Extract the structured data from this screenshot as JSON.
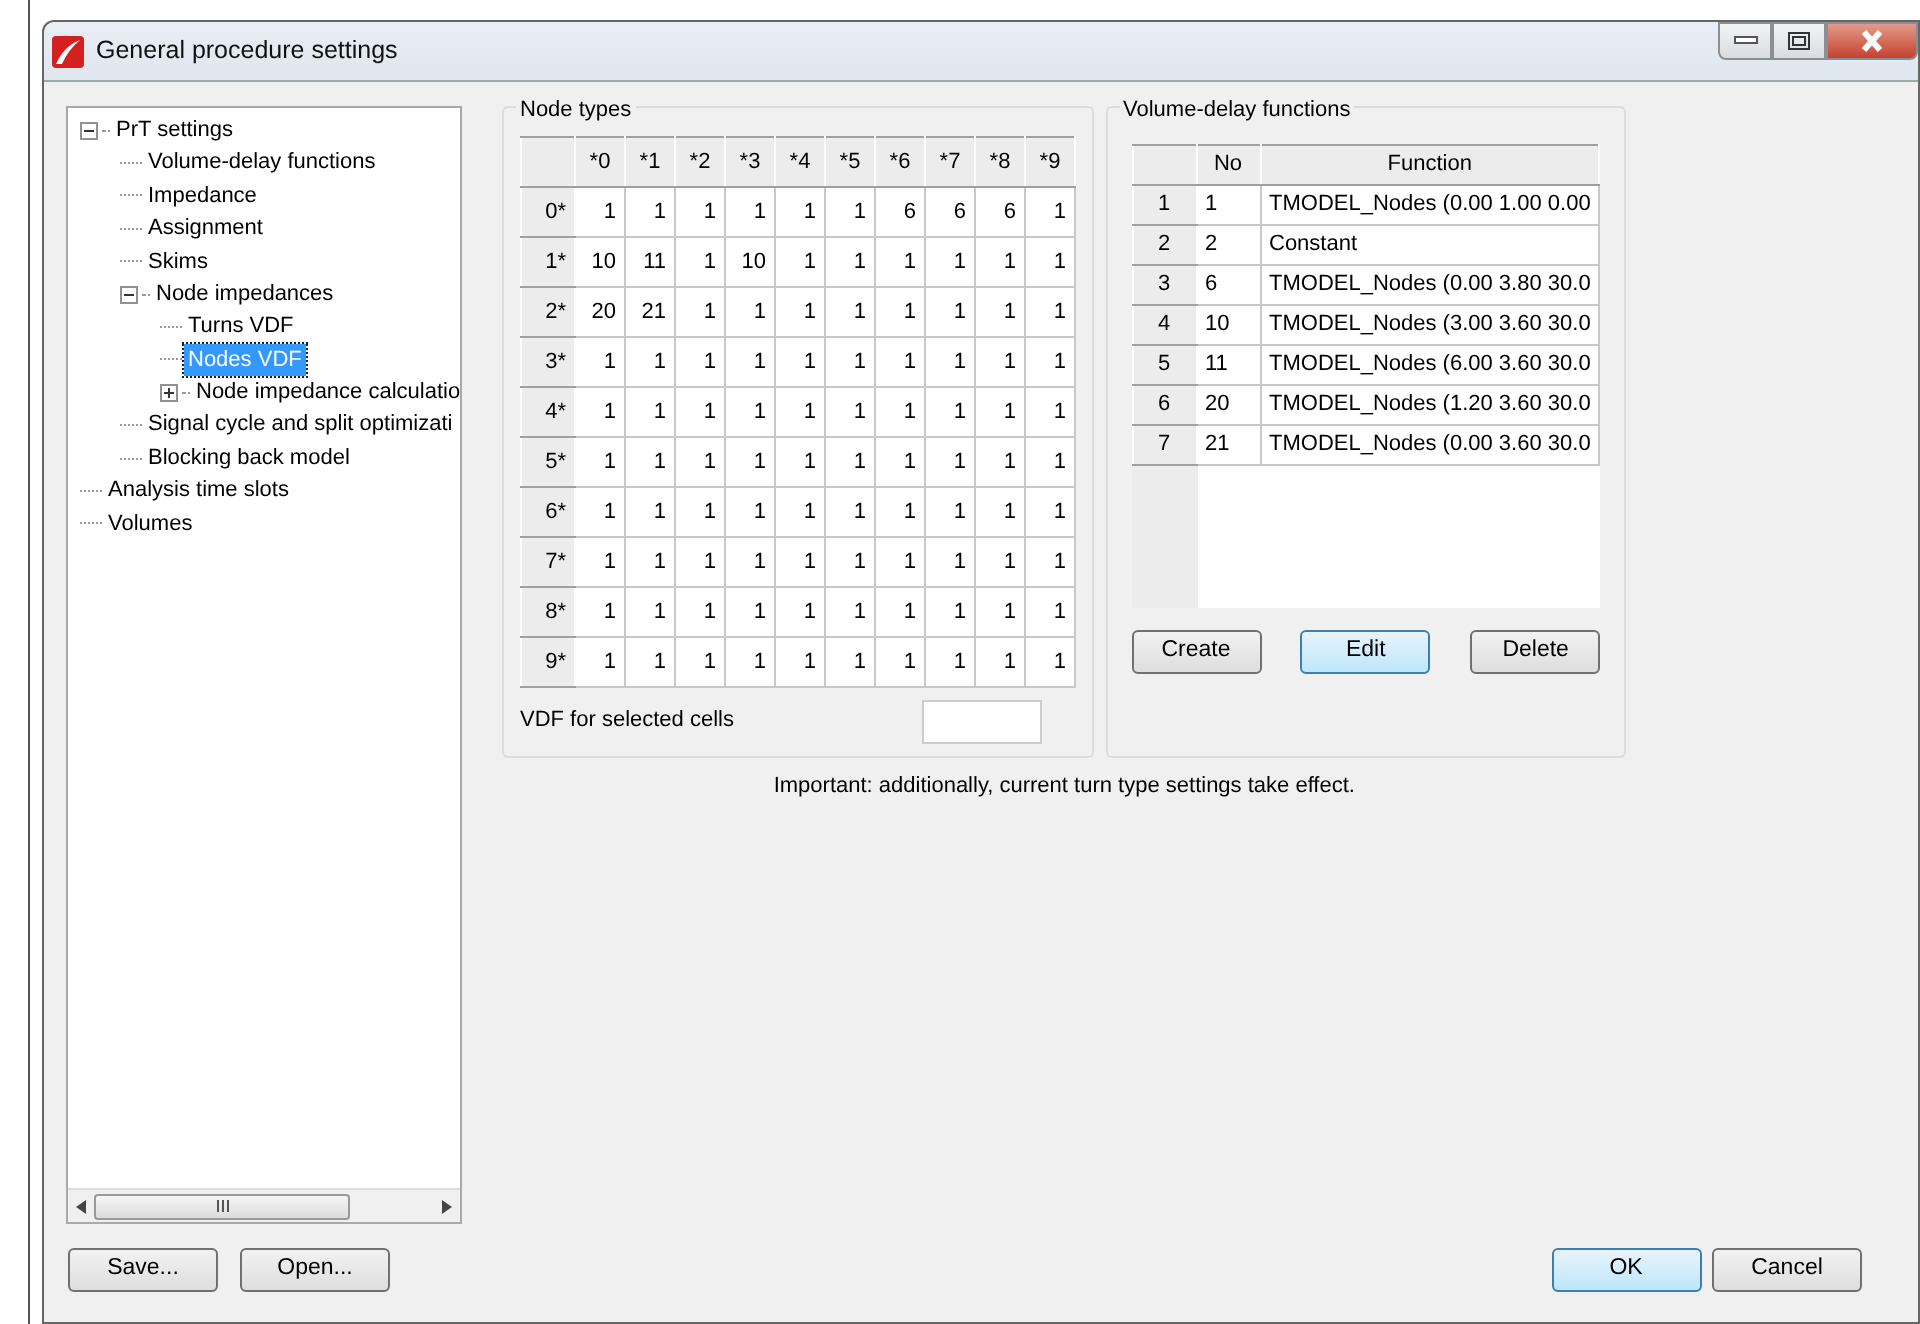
{
  "window": {
    "title": "General procedure settings"
  },
  "tree": [
    {
      "label": "PrT settings",
      "expanded": true,
      "selected": false,
      "children": [
        {
          "label": "Volume-delay functions",
          "selected": false
        },
        {
          "label": "Impedance",
          "selected": false
        },
        {
          "label": "Assignment",
          "selected": false
        },
        {
          "label": "Skims",
          "selected": false
        },
        {
          "label": "Node impedances",
          "expanded": true,
          "selected": false,
          "children": [
            {
              "label": "Turns VDF",
              "selected": false
            },
            {
              "label": "Nodes VDF",
              "selected": true
            },
            {
              "label": "Node impedance calculatio",
              "expanded": false,
              "selected": false
            }
          ]
        },
        {
          "label": "Signal cycle and split optimizati",
          "selected": false
        },
        {
          "label": "Blocking back model",
          "selected": false
        }
      ]
    },
    {
      "label": "Analysis time slots",
      "selected": false
    },
    {
      "label": "Volumes",
      "selected": false
    }
  ],
  "node_types": {
    "title": "Node types",
    "columns": [
      "*0",
      "*1",
      "*2",
      "*3",
      "*4",
      "*5",
      "*6",
      "*7",
      "*8",
      "*9"
    ],
    "rows": [
      {
        "header": "0*",
        "values": [
          "1",
          "1",
          "1",
          "1",
          "1",
          "1",
          "6",
          "6",
          "6",
          "1"
        ]
      },
      {
        "header": "1*",
        "values": [
          "10",
          "11",
          "1",
          "10",
          "1",
          "1",
          "1",
          "1",
          "1",
          "1"
        ]
      },
      {
        "header": "2*",
        "values": [
          "20",
          "21",
          "1",
          "1",
          "1",
          "1",
          "1",
          "1",
          "1",
          "1"
        ]
      },
      {
        "header": "3*",
        "values": [
          "1",
          "1",
          "1",
          "1",
          "1",
          "1",
          "1",
          "1",
          "1",
          "1"
        ]
      },
      {
        "header": "4*",
        "values": [
          "1",
          "1",
          "1",
          "1",
          "1",
          "1",
          "1",
          "1",
          "1",
          "1"
        ]
      },
      {
        "header": "5*",
        "values": [
          "1",
          "1",
          "1",
          "1",
          "1",
          "1",
          "1",
          "1",
          "1",
          "1"
        ]
      },
      {
        "header": "6*",
        "values": [
          "1",
          "1",
          "1",
          "1",
          "1",
          "1",
          "1",
          "1",
          "1",
          "1"
        ]
      },
      {
        "header": "7*",
        "values": [
          "1",
          "1",
          "1",
          "1",
          "1",
          "1",
          "1",
          "1",
          "1",
          "1"
        ]
      },
      {
        "header": "8*",
        "values": [
          "1",
          "1",
          "1",
          "1",
          "1",
          "1",
          "1",
          "1",
          "1",
          "1"
        ]
      },
      {
        "header": "9*",
        "values": [
          "1",
          "1",
          "1",
          "1",
          "1",
          "1",
          "1",
          "1",
          "1",
          "1"
        ]
      }
    ],
    "vdf_label": "VDF for selected cells"
  },
  "volume_delay_functions": {
    "title": "Volume-delay functions",
    "columns": [
      "No",
      "Function"
    ],
    "rows": [
      {
        "index": "1",
        "no": "1",
        "function": "TMODEL_Nodes (0.00 1.00 0.00"
      },
      {
        "index": "2",
        "no": "2",
        "function": "Constant"
      },
      {
        "index": "3",
        "no": "6",
        "function": "TMODEL_Nodes (0.00 3.80 30.0"
      },
      {
        "index": "4",
        "no": "10",
        "function": "TMODEL_Nodes (3.00 3.60 30.0"
      },
      {
        "index": "5",
        "no": "11",
        "function": "TMODEL_Nodes (6.00 3.60 30.0"
      },
      {
        "index": "6",
        "no": "20",
        "function": "TMODEL_Nodes (1.20 3.60 30.0"
      },
      {
        "index": "7",
        "no": "21",
        "function": "TMODEL_Nodes (0.00 3.60 30.0"
      }
    ],
    "buttons": [
      {
        "label": "Create",
        "focused": false
      },
      {
        "label": "Edit",
        "focused": true
      },
      {
        "label": "Delete",
        "focused": false
      }
    ]
  },
  "note": "Important: additionally, current turn type settings take effect.",
  "footer": {
    "left_buttons": [
      {
        "label": "Save...",
        "focused": false
      },
      {
        "label": "Open...",
        "focused": false
      }
    ],
    "right_buttons": [
      {
        "label": "OK",
        "focused": true
      },
      {
        "label": "Cancel",
        "focused": false
      }
    ]
  }
}
